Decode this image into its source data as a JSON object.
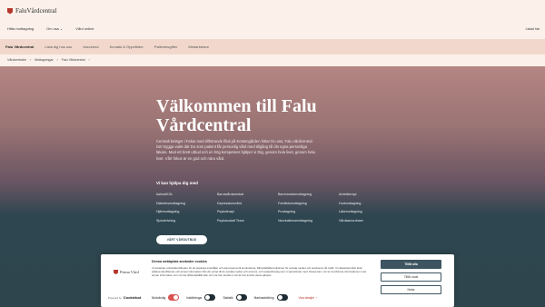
{
  "header": {
    "logo_text": "FaluVårdcentral",
    "topnav": [
      "Hitta mottagning",
      "Om oss",
      "Vård online"
    ],
    "topright": "Listad här"
  },
  "subnav": [
    "Falu Vårdcentral",
    "Lista dig hos oss",
    "Vaccinera",
    "Kontakt & Öppettider",
    "Patientavgifter",
    "Medarbetare"
  ],
  "breadcrumb": [
    "Vårdcentraler",
    "Mottagningar",
    "Falu Vårdcentral"
  ],
  "hero": {
    "title": "Välkommen till Falu Vårdcentral",
    "text": "Centralt beläget i Falun med tillhörande filial på Kostengården hittar Du oss, Falu vårdcentral. Det trygga valet där Du som patient får personlig vård med tillgång till din egna personliga läkare. Med ett brett utbud och en hög kompetens hjälper vi Dig, genom hela livet, genom hela livet. Vårt fokus är en god och nära vård.",
    "help_title": "Vi kan hjälpa dig med",
    "help_items": [
      "Astma/KOL",
      "Barnavårdscentral",
      "Barnmorskemottagning",
      "Arbetsterapi",
      "Diabetesmottagning",
      "Depressionsvård",
      "Fotvårdsmottagning",
      "Hudmottagning",
      "Hjärtmottagning",
      "Psykoterapi",
      "Provtagning",
      "Läkemottagning",
      "Sjukskrivning",
      "Psykosocialt Team",
      "Vaccinationsmottagning",
      "Vårdsamordnare"
    ],
    "cta": "VÅRT VÅRDUTBUD"
  },
  "cookie": {
    "logo_text": "Prima Vård",
    "powered_by": "Powered by",
    "powered_brand": "Cookiebot",
    "title": "Denna webbplats använder cookies",
    "body": "Vi använder enhetsidentifierare för att anpassa innehållet och annonserna till användarna, tillhandahålla funktioner för sociala medier och analysera vår trafik. Vi vidarebefordrar även sådana identifierare och annan information från din enhet till de sociala medier och annons- och analysföretag som vi samarbetar med. Dessa kan i sin tur kombinera informationen med annan information som du har tillhandahållit eller som de har samlat in när du har använt deras tjänster.",
    "toggles": [
      {
        "label": "Nödvändig",
        "on": true
      },
      {
        "label": "Inställningar",
        "on": false
      },
      {
        "label": "Statistik",
        "on": false
      },
      {
        "label": "Marknadsföring",
        "on": false
      }
    ],
    "details_label": "Visa detaljer",
    "allow_all": "Tillåt alla",
    "allow_selected": "Tillåt urval",
    "deny": "Neka"
  }
}
